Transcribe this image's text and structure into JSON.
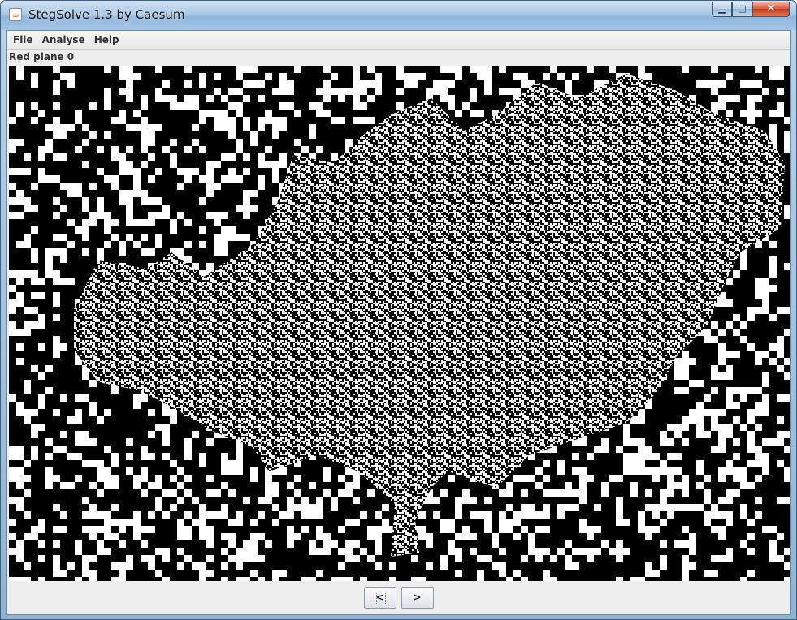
{
  "window": {
    "title": "StegSolve 1.3 by Caesum",
    "app_icon": "java-cup-icon",
    "controls": {
      "minimize_icon": "minimize-icon",
      "maximize_icon": "maximize-icon",
      "close_icon": "close-icon"
    }
  },
  "menu": {
    "items": [
      {
        "label": "File"
      },
      {
        "label": "Analyse"
      },
      {
        "label": "Help"
      }
    ]
  },
  "viewer": {
    "status": "Red plane 0",
    "image": "bit-plane noise image: black/white blocky pixel pattern with a dense gray-noise central shape"
  },
  "navigation": {
    "prev_label": "<",
    "next_label": ">"
  },
  "colors": {
    "title_bar": "#a9c8e6",
    "client_background": "#eeeeee",
    "image_black": "#000000",
    "image_white": "#ffffff"
  }
}
